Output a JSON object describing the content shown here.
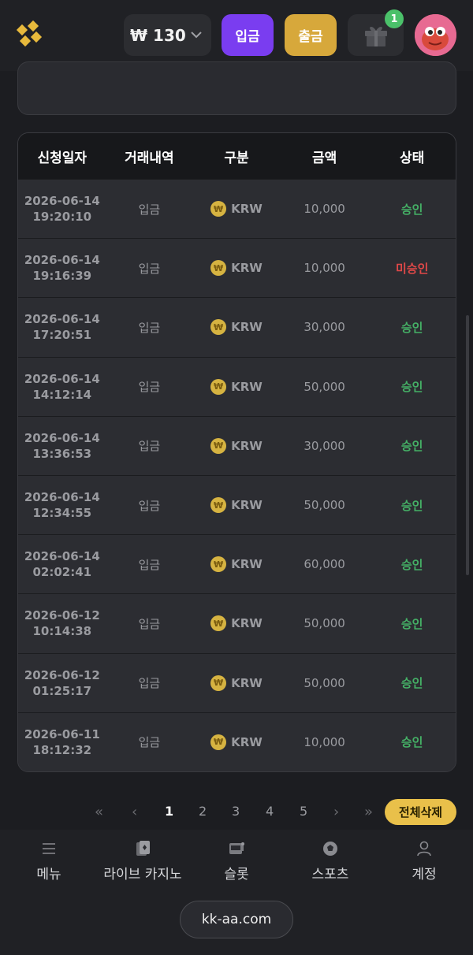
{
  "header": {
    "balance": "₩ 130",
    "deposit_label": "입금",
    "withdraw_label": "출금",
    "gift_badge_count": "1"
  },
  "table": {
    "columns": [
      "신청일자",
      "거래내역",
      "구분",
      "금액",
      "상태"
    ],
    "rows": [
      {
        "date": "2026-06-14",
        "time": "19:20:10",
        "type": "입금",
        "currency": "KRW",
        "amount": "10,000",
        "status": "승인",
        "status_kind": "approved"
      },
      {
        "date": "2026-06-14",
        "time": "19:16:39",
        "type": "입금",
        "currency": "KRW",
        "amount": "10,000",
        "status": "미승인",
        "status_kind": "rejected"
      },
      {
        "date": "2026-06-14",
        "time": "17:20:51",
        "type": "입금",
        "currency": "KRW",
        "amount": "30,000",
        "status": "승인",
        "status_kind": "approved"
      },
      {
        "date": "2026-06-14",
        "time": "14:12:14",
        "type": "입금",
        "currency": "KRW",
        "amount": "50,000",
        "status": "승인",
        "status_kind": "approved"
      },
      {
        "date": "2026-06-14",
        "time": "13:36:53",
        "type": "입금",
        "currency": "KRW",
        "amount": "30,000",
        "status": "승인",
        "status_kind": "approved"
      },
      {
        "date": "2026-06-14",
        "time": "12:34:55",
        "type": "입금",
        "currency": "KRW",
        "amount": "50,000",
        "status": "승인",
        "status_kind": "approved"
      },
      {
        "date": "2026-06-14",
        "time": "02:02:41",
        "type": "입금",
        "currency": "KRW",
        "amount": "60,000",
        "status": "승인",
        "status_kind": "approved"
      },
      {
        "date": "2026-06-12",
        "time": "10:14:38",
        "type": "입금",
        "currency": "KRW",
        "amount": "50,000",
        "status": "승인",
        "status_kind": "approved"
      },
      {
        "date": "2026-06-12",
        "time": "01:25:17",
        "type": "입금",
        "currency": "KRW",
        "amount": "50,000",
        "status": "승인",
        "status_kind": "approved"
      },
      {
        "date": "2026-06-11",
        "time": "18:12:32",
        "type": "입금",
        "currency": "KRW",
        "amount": "10,000",
        "status": "승인",
        "status_kind": "approved"
      }
    ]
  },
  "pagination": {
    "first": "«",
    "prev": "‹",
    "pages": [
      "1",
      "2",
      "3",
      "4",
      "5"
    ],
    "current": "1",
    "next": "›",
    "last": "»",
    "delete_all_label": "전체삭제"
  },
  "bottom_nav": {
    "items": [
      {
        "label": "메뉴",
        "icon": "menu-icon"
      },
      {
        "label": "라이브 카지노",
        "icon": "cards-icon"
      },
      {
        "label": "슬롯",
        "icon": "slot-machine-icon"
      },
      {
        "label": "스포츠",
        "icon": "soccer-ball-icon"
      },
      {
        "label": "계정",
        "icon": "user-icon"
      }
    ]
  },
  "url": "kk-aa.com",
  "colors": {
    "deposit": "#7a3df0",
    "withdraw": "#d7a83b",
    "approved": "#45b066",
    "rejected": "#e04848",
    "accent": "#e9c04a"
  }
}
